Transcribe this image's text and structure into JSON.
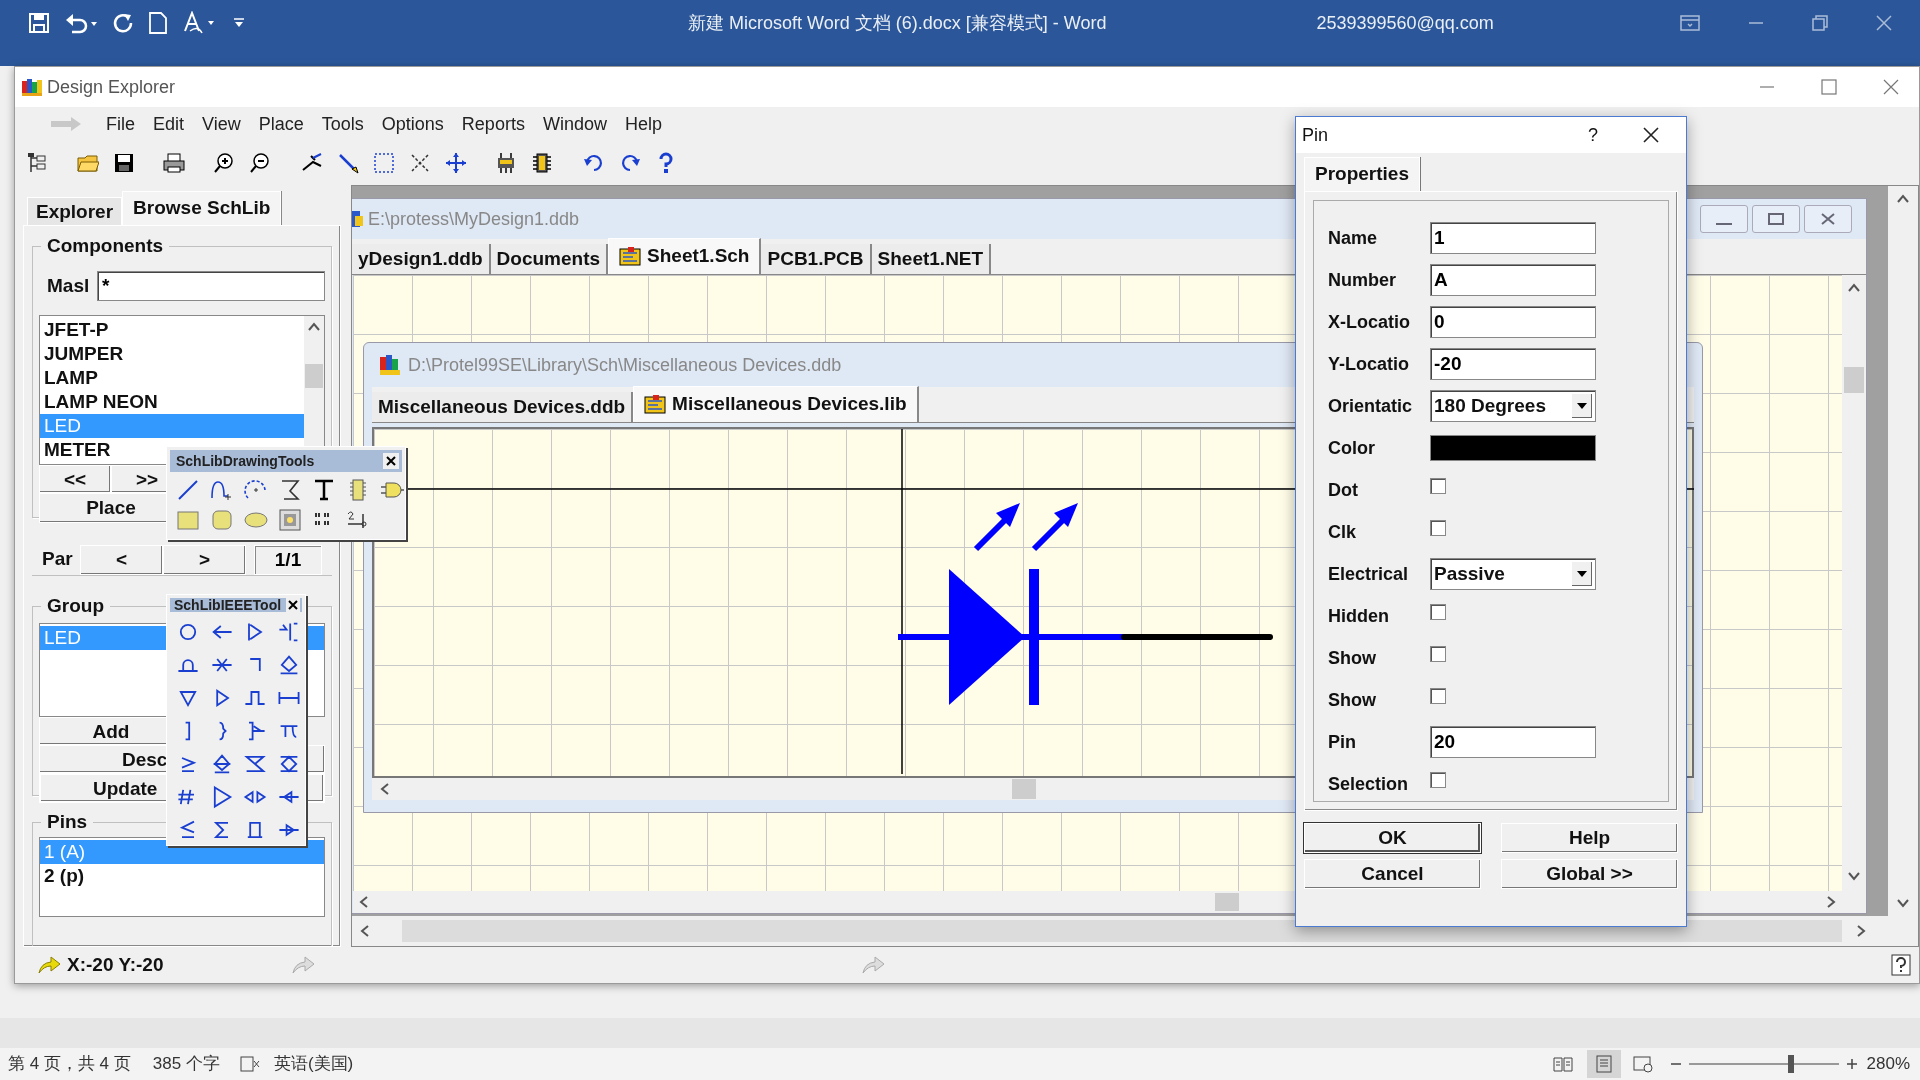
{
  "word": {
    "title": "新建 Microsoft Word 文档 (6).docx [兼容模式]  -  Word",
    "account": "2539399560@qq.com"
  },
  "app": {
    "title": "Design Explorer",
    "menu": [
      "File",
      "Edit",
      "View",
      "Place",
      "Tools",
      "Options",
      "Reports",
      "Window",
      "Help"
    ]
  },
  "side_panel": {
    "tabs": [
      {
        "label": "Explorer",
        "selected": false
      },
      {
        "label": "Browse SchLib",
        "selected": true
      }
    ],
    "components": {
      "legend": "Components",
      "mask_label": "Masl",
      "mask_value": "*",
      "items": [
        {
          "label": "JFET-P",
          "selected": false
        },
        {
          "label": "JUMPER",
          "selected": false
        },
        {
          "label": "LAMP",
          "selected": false
        },
        {
          "label": "LAMP NEON",
          "selected": false
        },
        {
          "label": "LED",
          "selected": true
        },
        {
          "label": "METER",
          "selected": false
        }
      ],
      "nav_buttons": [
        "<<",
        ">>"
      ],
      "place_button": "Place"
    },
    "part": {
      "label": "Par",
      "prev": "<",
      "next": ">",
      "count": "1/1"
    },
    "group": {
      "legend": "Group",
      "items": [
        {
          "label": "LED",
          "selected": true
        }
      ],
      "buttons": [
        "Add",
        "Desc",
        "Update"
      ]
    },
    "pins": {
      "legend": "Pins",
      "items": [
        {
          "label": "1  (A)",
          "selected": true
        },
        {
          "label": "2  (p)",
          "selected": false
        }
      ]
    }
  },
  "drawing_tools": {
    "title": "SchLibDrawingTools"
  },
  "ieee_tools": {
    "title": "SchLibIEEETool"
  },
  "design_window": {
    "title": "E:\\protess\\MyDesign1.ddb",
    "tabs": [
      {
        "label": "yDesign1.ddb",
        "selected": false
      },
      {
        "label": "Documents",
        "selected": false
      },
      {
        "label": "Sheet1.Sch",
        "selected": true
      },
      {
        "label": "PCB1.PCB",
        "selected": false
      },
      {
        "label": "Sheet1.NET",
        "selected": false
      }
    ]
  },
  "library_window": {
    "title": "D:\\Protel99SE\\Library\\Sch\\Miscellaneous Devices.ddb",
    "tabs": [
      {
        "label": "Miscellaneous Devices.ddb",
        "selected": false
      },
      {
        "label": "Miscellaneous Devices.lib",
        "selected": true
      }
    ]
  },
  "pin_dialog": {
    "title": "Pin",
    "help": "?",
    "tabs": [
      {
        "label": "Properties",
        "selected": true
      }
    ],
    "fields": [
      {
        "label": "Name",
        "kind": "text",
        "value": "1"
      },
      {
        "label": "Number",
        "kind": "text",
        "value": "A"
      },
      {
        "label": "X-Locatio",
        "kind": "text",
        "value": "0"
      },
      {
        "label": "Y-Locatio",
        "kind": "text",
        "value": "-20"
      },
      {
        "label": "Orientatic",
        "kind": "select",
        "value": "180 Degrees"
      },
      {
        "label": "Color",
        "kind": "color",
        "color": "#000000"
      },
      {
        "label": "Dot",
        "kind": "checkbox",
        "checked": false
      },
      {
        "label": "Clk",
        "kind": "checkbox",
        "checked": false
      },
      {
        "label": "Electrical",
        "kind": "select",
        "value": "Passive"
      },
      {
        "label": "Hidden",
        "kind": "checkbox",
        "checked": false
      },
      {
        "label": "Show",
        "kind": "checkbox",
        "checked": false
      },
      {
        "label": "Show",
        "kind": "checkbox",
        "checked": false
      },
      {
        "label": "Pin",
        "kind": "text",
        "value": "20"
      },
      {
        "label": "Selection",
        "kind": "checkbox",
        "checked": false
      }
    ],
    "buttons": [
      "OK",
      "Help",
      "Cancel",
      "Global >>"
    ]
  },
  "status_bar": {
    "coordinates": "X:-20 Y:-20"
  },
  "word_status": {
    "page": "第 4 页，共 4 页",
    "words": "385 个字",
    "language": "英语(美国)",
    "zoom": "280%",
    "zoom_slider": {
      "level": 0.68
    }
  }
}
